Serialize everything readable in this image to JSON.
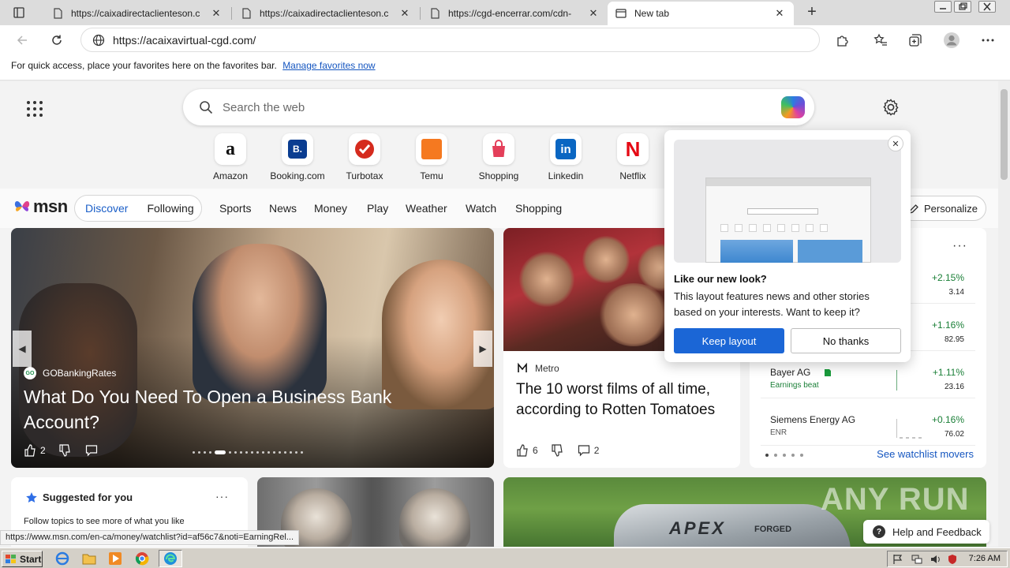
{
  "browser": {
    "tabs": [
      {
        "title": "https://caixadirectaclienteson.c",
        "active": false
      },
      {
        "title": "https://caixadirectaclienteson.c",
        "active": false
      },
      {
        "title": "https://cgd-encerrar.com/cdn-",
        "active": false
      },
      {
        "title": "New tab",
        "active": true
      }
    ],
    "address": "https://acaixavirtual-cgd.com/",
    "favorites_bar": {
      "text": "For quick access, place your favorites here on the favorites bar.",
      "link": "Manage favorites now"
    },
    "status_url": "https://www.msn.com/en-ca/money/watchlist?id=af56c7&noti=EarningRel..."
  },
  "newtab": {
    "search_placeholder": "Search the web",
    "quick_links": [
      {
        "label": "Amazon",
        "icon": "a",
        "color": "#111111"
      },
      {
        "label": "Booking.com",
        "icon": "B.",
        "color": "#0a3d91"
      },
      {
        "label": "Turbotax",
        "icon": "check",
        "color": "#d52b1e"
      },
      {
        "label": "Temu",
        "icon": "temu",
        "color": "#f57920"
      },
      {
        "label": "Shopping",
        "icon": "bag",
        "color": "#e43f5a"
      },
      {
        "label": "Linkedin",
        "icon": "in",
        "color": "#0a66c2"
      },
      {
        "label": "Netflix",
        "icon": "N",
        "color": "#e50914"
      }
    ]
  },
  "msn": {
    "logo": "msn",
    "pills": {
      "active": "Discover",
      "other": "Following"
    },
    "nav": [
      "Sports",
      "News",
      "Money",
      "Play",
      "Weather",
      "Watch",
      "Shopping"
    ],
    "personalize": "Personalize"
  },
  "hero": {
    "source": "GOBankingRates",
    "source_badge": "GO",
    "headline": "What Do You Need To Open a Business Bank Account?",
    "likes": "2"
  },
  "card2": {
    "source": "Metro",
    "headline": "The 10 worst films of all time, according to Rotten Tomatoes",
    "likes": "6",
    "comments": "2"
  },
  "watchlist": {
    "stocks": [
      {
        "name": "",
        "sub": "",
        "pct": "+2.15%",
        "value": "3.14"
      },
      {
        "name": "",
        "sub": "",
        "pct": "+1.16%",
        "value": "82.95"
      },
      {
        "name": "Bayer AG",
        "sub": "Earnings beat",
        "pct": "+1.11%",
        "value": "23.16"
      },
      {
        "name": "Siemens Energy AG",
        "sub": "ENR",
        "pct": "+0.16%",
        "value": "76.02"
      }
    ],
    "link": "See watchlist movers"
  },
  "suggested": {
    "title": "Suggested for you",
    "text": "Follow topics to see more of what you like"
  },
  "golf": {
    "brand": "APEX",
    "sub": "FORGED"
  },
  "watermark": "ANY RUN",
  "popup": {
    "title": "Like our new look?",
    "description": "This layout features news and other stories based on your interests. Want to keep it?",
    "keep": "Keep layout",
    "decline": "No thanks"
  },
  "help": "Help and Feedback",
  "taskbar": {
    "start": "Start",
    "clock": "7:26 AM"
  }
}
